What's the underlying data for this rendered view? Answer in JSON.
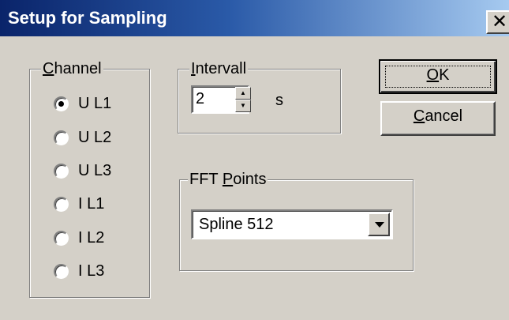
{
  "window": {
    "title": "Setup for Sampling",
    "close_glyph": "✕"
  },
  "channel_group": {
    "label_underlined": "C",
    "label_rest": "hannel",
    "options": [
      {
        "label": "U L1",
        "selected": true
      },
      {
        "label": "U L2",
        "selected": false
      },
      {
        "label": "U L3",
        "selected": false
      },
      {
        "label": "I L1",
        "selected": false
      },
      {
        "label": "I L2",
        "selected": false
      },
      {
        "label": "I L3",
        "selected": false
      }
    ]
  },
  "interval_group": {
    "label_underlined": "I",
    "label_rest": "ntervall",
    "value": "2",
    "unit": "s"
  },
  "fft_group": {
    "label_prefix": "FFT ",
    "label_underlined": "P",
    "label_rest": "oints",
    "selected_value": "Spline 512"
  },
  "buttons": {
    "ok_underlined": "O",
    "ok_rest": "K",
    "cancel_underlined": "C",
    "cancel_rest": "ancel"
  },
  "colors": {
    "dialog_bg": "#d4d0c8",
    "titlebar_start": "#0a246a",
    "titlebar_end": "#a6caf0",
    "title_text": "#ffffff"
  }
}
